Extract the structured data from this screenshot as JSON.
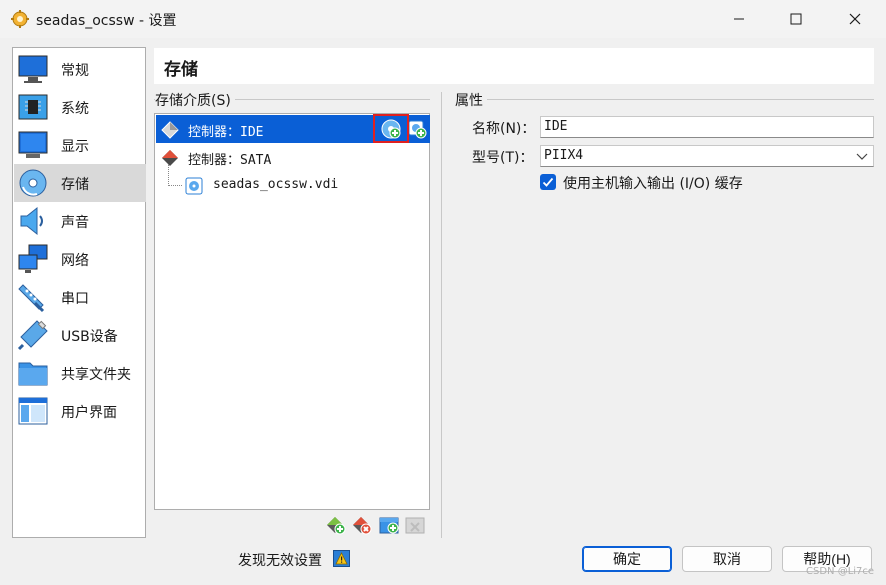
{
  "window": {
    "title": "seadas_ocssw - 设置",
    "minimize_label": "Minimize",
    "maximize_label": "Maximize",
    "close_label": "Close"
  },
  "sidebar": {
    "items": [
      {
        "label": "常规",
        "icon": "general-monitor-icon"
      },
      {
        "label": "系统",
        "icon": "system-chip-icon"
      },
      {
        "label": "显示",
        "icon": "display-monitor-icon"
      },
      {
        "label": "存储",
        "icon": "storage-disk-icon",
        "selected": true
      },
      {
        "label": "声音",
        "icon": "audio-speaker-icon"
      },
      {
        "label": "网络",
        "icon": "network-icon"
      },
      {
        "label": "串口",
        "icon": "serial-port-icon"
      },
      {
        "label": "USB设备",
        "icon": "usb-icon"
      },
      {
        "label": "共享文件夹",
        "icon": "shared-folder-icon"
      },
      {
        "label": "用户界面",
        "icon": "user-interface-icon"
      }
    ]
  },
  "page": {
    "title": "存储"
  },
  "storage": {
    "group_label": "存储介质(S)",
    "tree": [
      {
        "label": "控制器：IDE",
        "type": "controller",
        "selected": true
      },
      {
        "label": "控制器：SATA",
        "type": "controller"
      },
      {
        "label": "seadas_ocssw.vdi",
        "type": "disk"
      }
    ],
    "add_optical_tooltip": "添加光驱",
    "add_hard_disk_tooltip": "添加虚拟硬盘",
    "toolbar": {
      "add_controller": "添加控制器",
      "remove_controller": "删除控制器",
      "add_attachment": "添加虚拟介质",
      "remove_attachment": "删除虚拟介质"
    }
  },
  "properties": {
    "group_label": "属性",
    "name_label": "名称(N)：",
    "name_value": "IDE",
    "type_label": "型号(T)：",
    "type_value": "PIIX4",
    "io_cache_label": "使用主机输入输出 (I/O) 缓存",
    "io_cache_checked": true
  },
  "footer": {
    "status": "发现无效设置",
    "ok": "确定",
    "cancel": "取消",
    "help": "帮助(H)"
  },
  "watermark": "CSDN @Li7ce",
  "colors": {
    "selection": "#0a5fd6",
    "highlight_box": "#e02020",
    "background": "#f0f0f0"
  }
}
